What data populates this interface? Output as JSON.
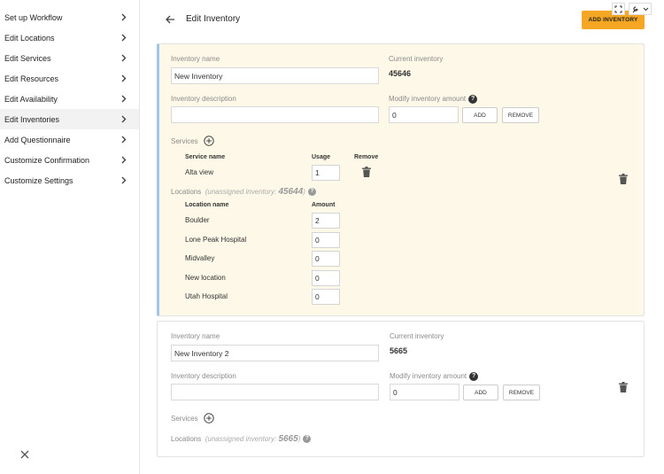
{
  "sidebar": {
    "items": [
      {
        "label": "Set up Workflow"
      },
      {
        "label": "Edit Locations"
      },
      {
        "label": "Edit Services"
      },
      {
        "label": "Edit Resources"
      },
      {
        "label": "Edit Availability"
      },
      {
        "label": "Edit Inventories",
        "active": true
      },
      {
        "label": "Add Questionnaire"
      },
      {
        "label": "Customize Confirmation"
      },
      {
        "label": "Customize Settings"
      }
    ]
  },
  "header": {
    "title": "Edit Inventory",
    "add_button": "ADD INVENTORY"
  },
  "labels": {
    "inventory_name": "Inventory name",
    "current_inventory": "Current inventory",
    "inventory_description": "Inventory description",
    "modify_amount": "Modify inventory amount",
    "add": "ADD",
    "remove": "REMOVE",
    "services": "Services",
    "service_name": "Service name",
    "usage": "Usage",
    "remove_col": "Remove",
    "locations": "Locations",
    "unassigned_open": "(unassigned inventory:",
    "unassigned_close": ")",
    "location_name": "Location name",
    "amount": "Amount"
  },
  "inventories": [
    {
      "name": "New Inventory",
      "current": "45646",
      "description": "",
      "modify_value": "0",
      "unassigned": "45644",
      "services": [
        {
          "name": "Alta view",
          "usage": "1"
        }
      ],
      "locations": [
        {
          "name": "Boulder",
          "amount": "2"
        },
        {
          "name": "Lone Peak Hospital",
          "amount": "0"
        },
        {
          "name": "Midvalley",
          "amount": "0"
        },
        {
          "name": "New location",
          "amount": "0"
        },
        {
          "name": "Utah Hospital",
          "amount": "0"
        }
      ]
    },
    {
      "name": "New Inventory 2",
      "current": "5665",
      "description": "",
      "modify_value": "0",
      "unassigned": "5665"
    }
  ],
  "colors": {
    "accent": "#f5a623",
    "selected_card": "#fdf8e8",
    "selected_border": "#9fc5e8"
  }
}
